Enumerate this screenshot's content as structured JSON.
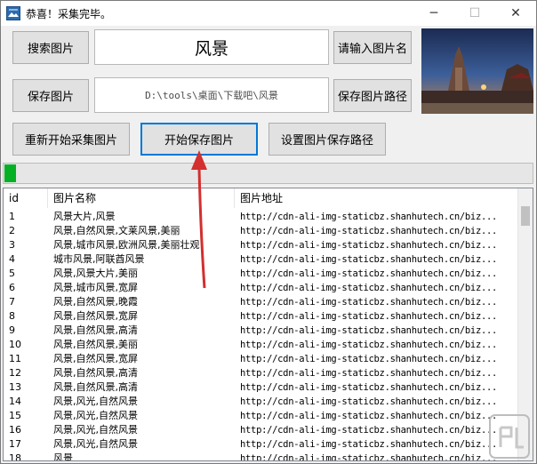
{
  "window": {
    "title": "恭喜！采集完毕。",
    "minimize": "─",
    "maximize": "☐",
    "close": "✕"
  },
  "controls": {
    "search_button": "搜索图片",
    "keyword_value": "风景",
    "name_button": "请输入图片名",
    "save_button": "保存图片",
    "save_path_value": "D:\\tools\\桌面\\下载吧\\风景",
    "path_button": "保存图片路径",
    "restart_button": "重新开始采集图片",
    "start_save_button": "开始保存图片",
    "set_path_button": "设置图片保存路径"
  },
  "progress": {
    "fraction": 0.022,
    "color": "#06b025"
  },
  "table": {
    "headers": [
      "id",
      "图片名称",
      "图片地址"
    ],
    "rows": [
      {
        "id": "1",
        "name": "风景大片,风景",
        "url": "http://cdn-ali-img-staticbz.shanhutech.cn/biz..."
      },
      {
        "id": "2",
        "name": "风景,自然风景,文莱风景,美丽",
        "url": "http://cdn-ali-img-staticbz.shanhutech.cn/biz..."
      },
      {
        "id": "3",
        "name": "风景,城市风景,欧洲风景,美丽壮观",
        "url": "http://cdn-ali-img-staticbz.shanhutech.cn/biz..."
      },
      {
        "id": "4",
        "name": "城市风景,阿联酋风景",
        "url": "http://cdn-ali-img-staticbz.shanhutech.cn/biz..."
      },
      {
        "id": "5",
        "name": "风景,风景大片,美丽",
        "url": "http://cdn-ali-img-staticbz.shanhutech.cn/biz..."
      },
      {
        "id": "6",
        "name": "风景,城市风景,宽屏",
        "url": "http://cdn-ali-img-staticbz.shanhutech.cn/biz..."
      },
      {
        "id": "7",
        "name": "风景,自然风景,晚霞",
        "url": "http://cdn-ali-img-staticbz.shanhutech.cn/biz..."
      },
      {
        "id": "8",
        "name": "风景,自然风景,宽屏",
        "url": "http://cdn-ali-img-staticbz.shanhutech.cn/biz..."
      },
      {
        "id": "9",
        "name": "风景,自然风景,高清",
        "url": "http://cdn-ali-img-staticbz.shanhutech.cn/biz..."
      },
      {
        "id": "10",
        "name": "风景,自然风景,美丽",
        "url": "http://cdn-ali-img-staticbz.shanhutech.cn/biz..."
      },
      {
        "id": "11",
        "name": "风景,自然风景,宽屏",
        "url": "http://cdn-ali-img-staticbz.shanhutech.cn/biz..."
      },
      {
        "id": "12",
        "name": "风景,自然风景,高清",
        "url": "http://cdn-ali-img-staticbz.shanhutech.cn/biz..."
      },
      {
        "id": "13",
        "name": "风景,自然风景,高清",
        "url": "http://cdn-ali-img-staticbz.shanhutech.cn/biz..."
      },
      {
        "id": "14",
        "name": "风景,风光,自然风景",
        "url": "http://cdn-ali-img-staticbz.shanhutech.cn/biz..."
      },
      {
        "id": "15",
        "name": "风景,风光,自然风景",
        "url": "http://cdn-ali-img-staticbz.shanhutech.cn/biz..."
      },
      {
        "id": "16",
        "name": "风景,风光,自然风景",
        "url": "http://cdn-ali-img-staticbz.shanhutech.cn/biz..."
      },
      {
        "id": "17",
        "name": "风景,风光,自然风景",
        "url": "http://cdn-ali-img-staticbz.shanhutech.cn/biz..."
      },
      {
        "id": "18",
        "name": "风景",
        "url": "http://cdn-ali-img-staticbz.shanhutech.cn/biz..."
      }
    ]
  },
  "icons": {
    "app": "picture-icon",
    "preview": "landscape-thumbnail",
    "arrow": "red-annotation-arrow",
    "watermark": "site-watermark"
  },
  "colors": {
    "arrow": "#d32f2f",
    "focus": "#0078d7"
  }
}
